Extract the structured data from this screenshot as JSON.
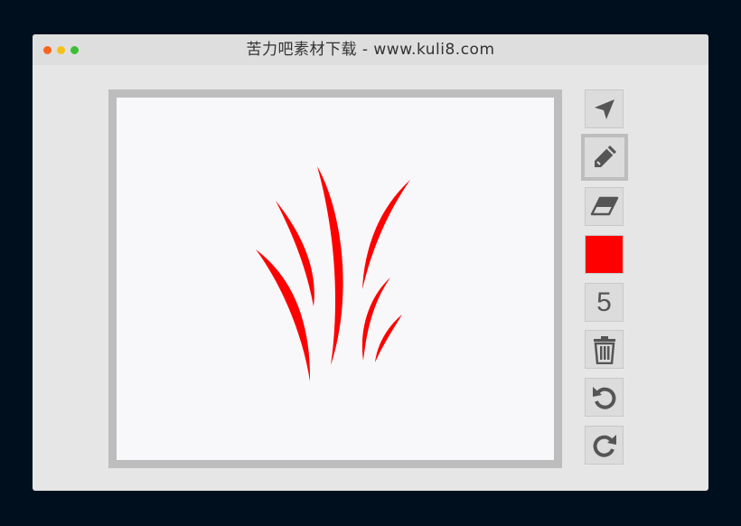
{
  "window": {
    "title": "苦力吧素材下载 - www.kuli8.com",
    "traffic_lights": {
      "close_color": "#f6651d",
      "minimize_color": "#f4c11a",
      "zoom_color": "#3dbf35"
    }
  },
  "toolbar": {
    "tools": [
      {
        "id": "select",
        "icon": "navigation-arrow-icon",
        "active": false
      },
      {
        "id": "pencil",
        "icon": "pencil-icon",
        "active": true
      },
      {
        "id": "eraser",
        "icon": "eraser-icon",
        "active": false
      }
    ],
    "color": {
      "value": "#ff0000"
    },
    "brush_size": "5",
    "actions": [
      {
        "id": "clear",
        "icon": "trash-icon"
      },
      {
        "id": "undo",
        "icon": "undo-icon"
      },
      {
        "id": "redo",
        "icon": "redo-icon"
      }
    ]
  },
  "canvas": {
    "background": "#f8f8fa",
    "frame_color": "#bdbdbd",
    "drawing": {
      "description_icon": "red-grass-strokes",
      "stroke_color": "#ff0000"
    }
  }
}
